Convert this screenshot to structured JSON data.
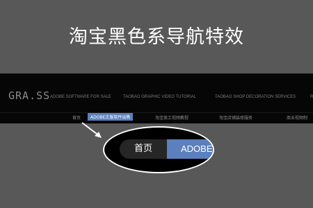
{
  "hero": {
    "title": "淘宝黑色系导航特效"
  },
  "nav": {
    "logo": "GRA.SS",
    "main_links": [
      "ADOBE SOFTWARE FOR SALE",
      "TAOBAO GRAPHIC VIDEO TUTORIAL",
      "TAOBAO SHOP DECORATION SERVICES",
      "R"
    ],
    "sub_links": [
      "首页",
      "ADOBE正版软件出售",
      "淘宝美工视频教程",
      "淘宝店铺装修服务",
      "商业视频制"
    ]
  },
  "magnifier": {
    "home_label": "首页",
    "active_label": "ADOBE"
  },
  "colors": {
    "background": "#585858",
    "navbar": "#060606",
    "accent": "#5b80bd"
  }
}
